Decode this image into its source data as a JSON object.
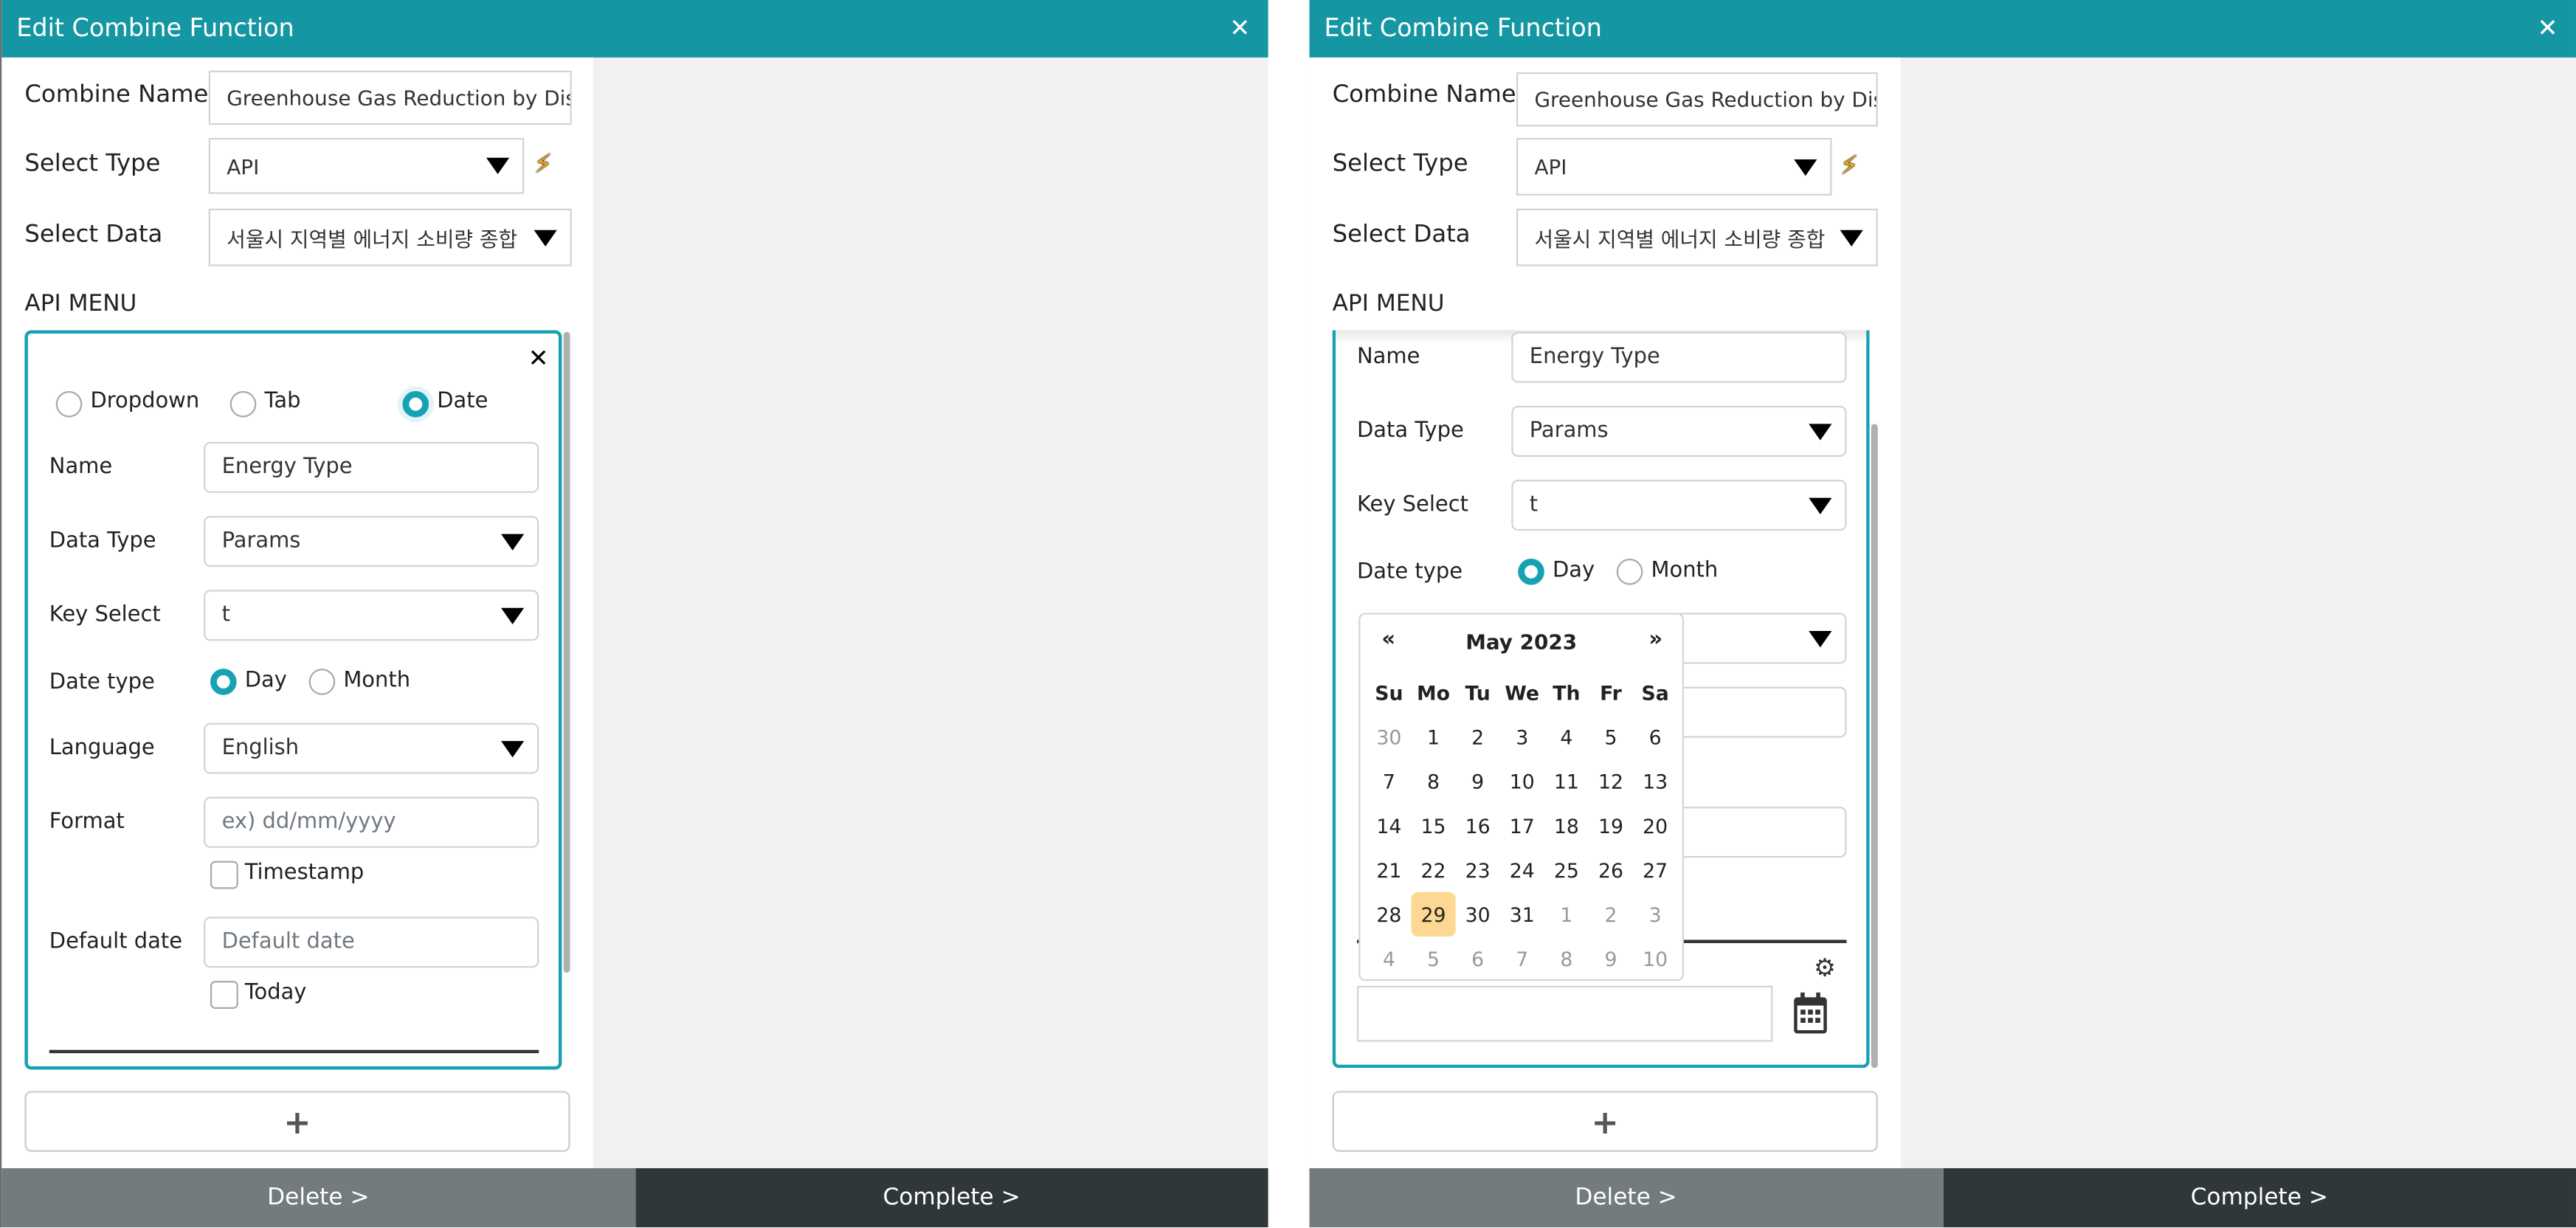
{
  "panels": [
    {
      "header": {
        "title": "Edit Combine Function",
        "close_icon": "close-icon"
      },
      "form": {
        "combine_name_label": "Combine Name",
        "combine_name_value": "Greenhouse Gas Reduction by Dis",
        "select_type_label": "Select Type",
        "select_type_value": "API",
        "select_data_label": "Select Data",
        "select_data_value": "서울시 지역별 에너지 소비량 종합",
        "api_menu_label": "API MENU"
      },
      "card": {
        "radio_options": [
          "Dropdown",
          "Tab",
          "Date"
        ],
        "radio_selected": "Date",
        "name_label": "Name",
        "name_value": "Energy Type",
        "data_type_label": "Data Type",
        "data_type_value": "Params",
        "key_select_label": "Key Select",
        "key_select_value": "t",
        "date_type_label": "Date type",
        "date_type_options": [
          "Day",
          "Month"
        ],
        "date_type_selected": "Day",
        "language_label": "Language",
        "language_value": "English",
        "format_label": "Format",
        "format_placeholder": "ex) dd/mm/yyyy",
        "timestamp_label": "Timestamp",
        "timestamp_checked": false,
        "default_date_label": "Default date",
        "default_date_placeholder": "Default date",
        "today_label": "Today",
        "today_checked": false
      },
      "add_button_label": "+",
      "footer": {
        "delete_label": "Delete >",
        "complete_label": "Complete >"
      }
    },
    {
      "header": {
        "title": "Edit Combine Function",
        "close_icon": "close-icon"
      },
      "form": {
        "combine_name_label": "Combine Name",
        "combine_name_value": "Greenhouse Gas Reduction by Dis",
        "select_type_label": "Select Type",
        "select_type_value": "API",
        "select_data_label": "Select Data",
        "select_data_value": "서울시 지역별 에너지 소비량 종합",
        "api_menu_label": "API MENU"
      },
      "card": {
        "name_label": "Name",
        "name_value": "Energy Type",
        "data_type_label": "Data Type",
        "data_type_value": "Params",
        "key_select_label": "Key Select",
        "key_select_value": "t",
        "date_type_label": "Date type",
        "date_type_options": [
          "Day",
          "Month"
        ],
        "date_type_selected": "Day",
        "date_input_value": ""
      },
      "datepicker": {
        "prev_label": "«",
        "next_label": "»",
        "month_label": "May 2023",
        "weekdays": [
          "Su",
          "Mo",
          "Tu",
          "We",
          "Th",
          "Fr",
          "Sa"
        ],
        "weeks": [
          [
            "30",
            "1",
            "2",
            "3",
            "4",
            "5",
            "6"
          ],
          [
            "7",
            "8",
            "9",
            "10",
            "11",
            "12",
            "13"
          ],
          [
            "14",
            "15",
            "16",
            "17",
            "18",
            "19",
            "20"
          ],
          [
            "21",
            "22",
            "23",
            "24",
            "25",
            "26",
            "27"
          ],
          [
            "28",
            "29",
            "30",
            "31",
            "1",
            "2",
            "3"
          ],
          [
            "4",
            "5",
            "6",
            "7",
            "8",
            "9",
            "10"
          ]
        ],
        "muted": [
          [
            0,
            0
          ],
          [
            4,
            4
          ],
          [
            4,
            5
          ],
          [
            4,
            6
          ],
          [
            5,
            0
          ],
          [
            5,
            1
          ],
          [
            5,
            2
          ],
          [
            5,
            3
          ],
          [
            5,
            4
          ],
          [
            5,
            5
          ],
          [
            5,
            6
          ]
        ],
        "selected_day": "29",
        "selected_color": "#fdd893"
      },
      "add_button_label": "+",
      "footer": {
        "delete_label": "Delete >",
        "complete_label": "Complete >"
      }
    }
  ],
  "colors": {
    "accent": "#1597a3",
    "card_border": "#17a2b3",
    "delete_bg": "#737b7e",
    "complete_bg": "#30373b",
    "bolt": "#f5a700"
  }
}
